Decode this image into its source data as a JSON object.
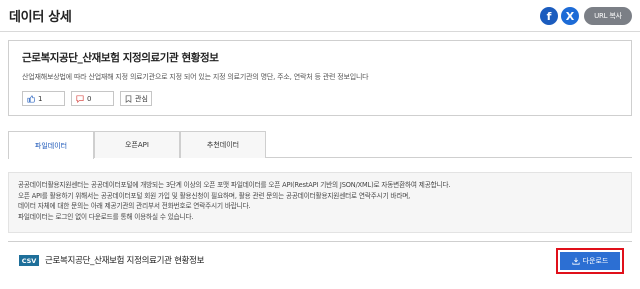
{
  "header": {
    "title": "데이터 상세",
    "share": {
      "facebook_icon": "f",
      "x_icon": "X",
      "url_copy_label": "URL 복사"
    }
  },
  "dataset": {
    "title": "근로복지공단_산재보험 지정의료기관 현황정보",
    "description": "산업재해보상법에 따라 산업재해 지정 의료기관으로 지정 되어 있는 지정 의료기관의 명단, 주소, 연락처 등 관련 정보입니다",
    "like_count": "1",
    "dislike_count": "0",
    "favorite_label": "관심"
  },
  "tabs": [
    {
      "label": "파일데이터",
      "active": true
    },
    {
      "label": "오픈API",
      "active": false
    },
    {
      "label": "추천데이터",
      "active": false
    }
  ],
  "notice": {
    "lines": [
      "공공데이터활용지원센터는 공공데이터포털에 개방되는 3단계 이상의 오픈 포맷 파일데이터를 오픈 API(RestAPI 기반의 JSON/XML)로 자동변환하여 제공합니다.",
      "오픈 API를 활용하기 위해서는 공공데이터포털 회원 가입 및 활용신청이 필요하며, 활용 관련 문의는 공공데이터활용지원센터로 연락주시기 바라며,",
      "데이터 자체에 대한 문의는 아래 제공기관의 관리부서 전화번호로 연락주시기 바랍니다.",
      "파일데이터는 로그인 없이 다운로드를 통해 이용하실 수 있습니다."
    ]
  },
  "file": {
    "format": "CSV",
    "name": "근로복지공단_산재보험 지정의료기관 현황정보",
    "download_label": "다운로드"
  },
  "colors": {
    "accent": "#2c6fd3",
    "highlight_border": "#e0101a",
    "csv_badge": "#1e6f9a",
    "facebook": "#1b5cbe"
  }
}
